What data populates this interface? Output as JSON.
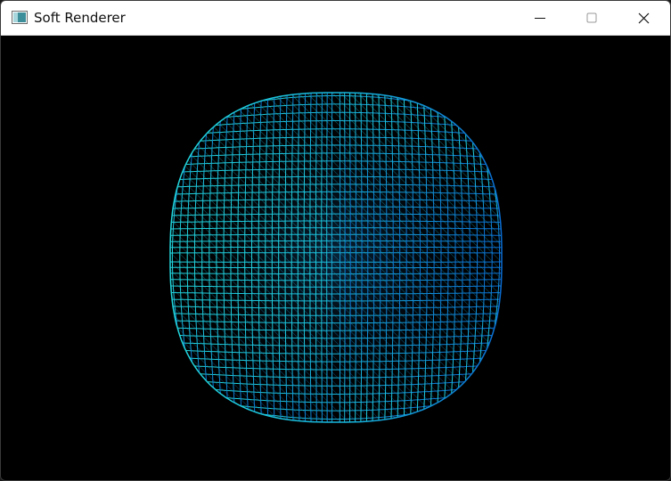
{
  "window": {
    "title": "Soft Renderer",
    "controls": {
      "minimize": "minimize-icon",
      "maximize": "maximize-icon",
      "close": "close-icon"
    }
  },
  "viewport": {
    "background": "#000000",
    "object": "wireframe-sphere",
    "color_left": "#1fd0d8",
    "color_right": "#0a6fd0"
  }
}
